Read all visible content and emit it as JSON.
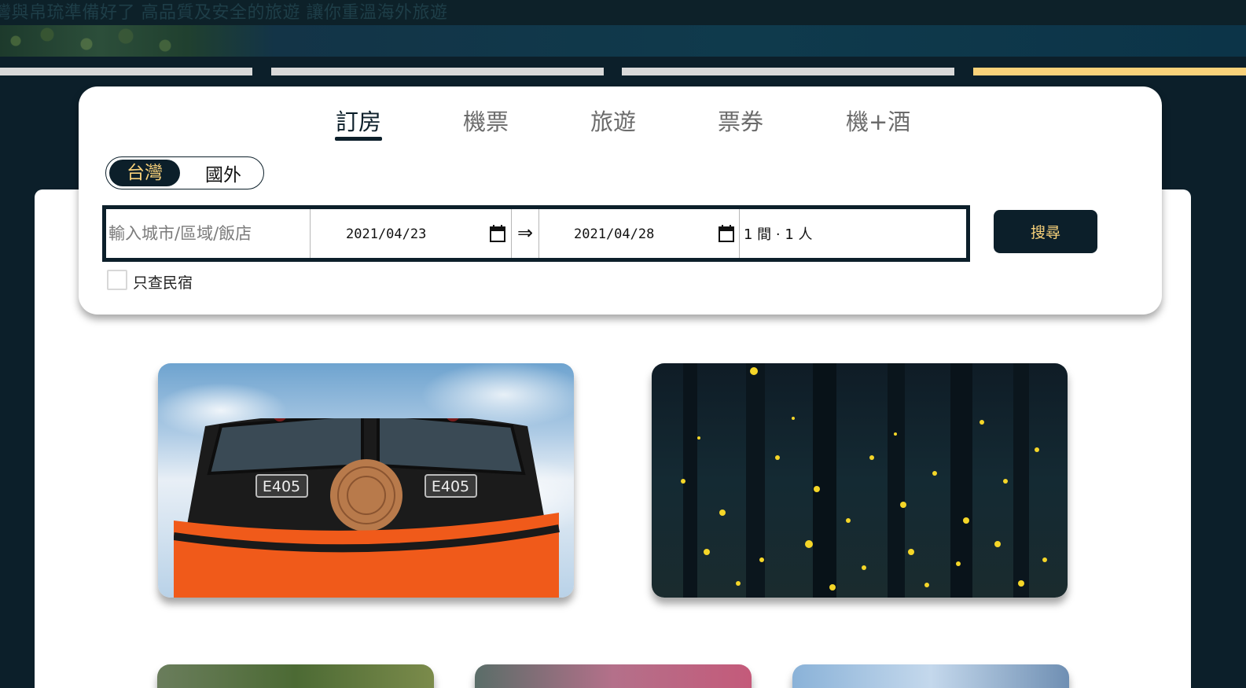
{
  "hero": {
    "slogan": "灣與帛琉準備好了 高品質及安全的旅遊 讓你重溫海外旅遊",
    "slides": [
      {
        "active": false
      },
      {
        "active": false
      },
      {
        "active": false
      },
      {
        "active": true
      }
    ]
  },
  "booking": {
    "tabs": [
      {
        "label": "訂房",
        "active": true
      },
      {
        "label": "機票",
        "active": false
      },
      {
        "label": "旅遊",
        "active": false
      },
      {
        "label": "票券",
        "active": false
      },
      {
        "label": "機+酒",
        "active": false
      }
    ],
    "region": {
      "options": [
        "台灣",
        "國外"
      ],
      "selected": "台灣"
    },
    "destination_placeholder": "輸入城市/區域/飯店",
    "checkin_date": "2021/04/23",
    "checkout_date": "2021/04/28",
    "date_arrow": "⇒",
    "guests": "1 間 · 1 人",
    "search_label": "搜尋",
    "bnb_only_label": "只查民宿",
    "bnb_only_checked": false
  },
  "colors": {
    "navy": "#0c1f2a",
    "accent_gold": "#f9d27a"
  },
  "destinations": [
    {
      "name": "train-photo",
      "train_numbers": [
        "E405",
        "E405"
      ]
    },
    {
      "name": "firefly-forest-photo"
    }
  ]
}
